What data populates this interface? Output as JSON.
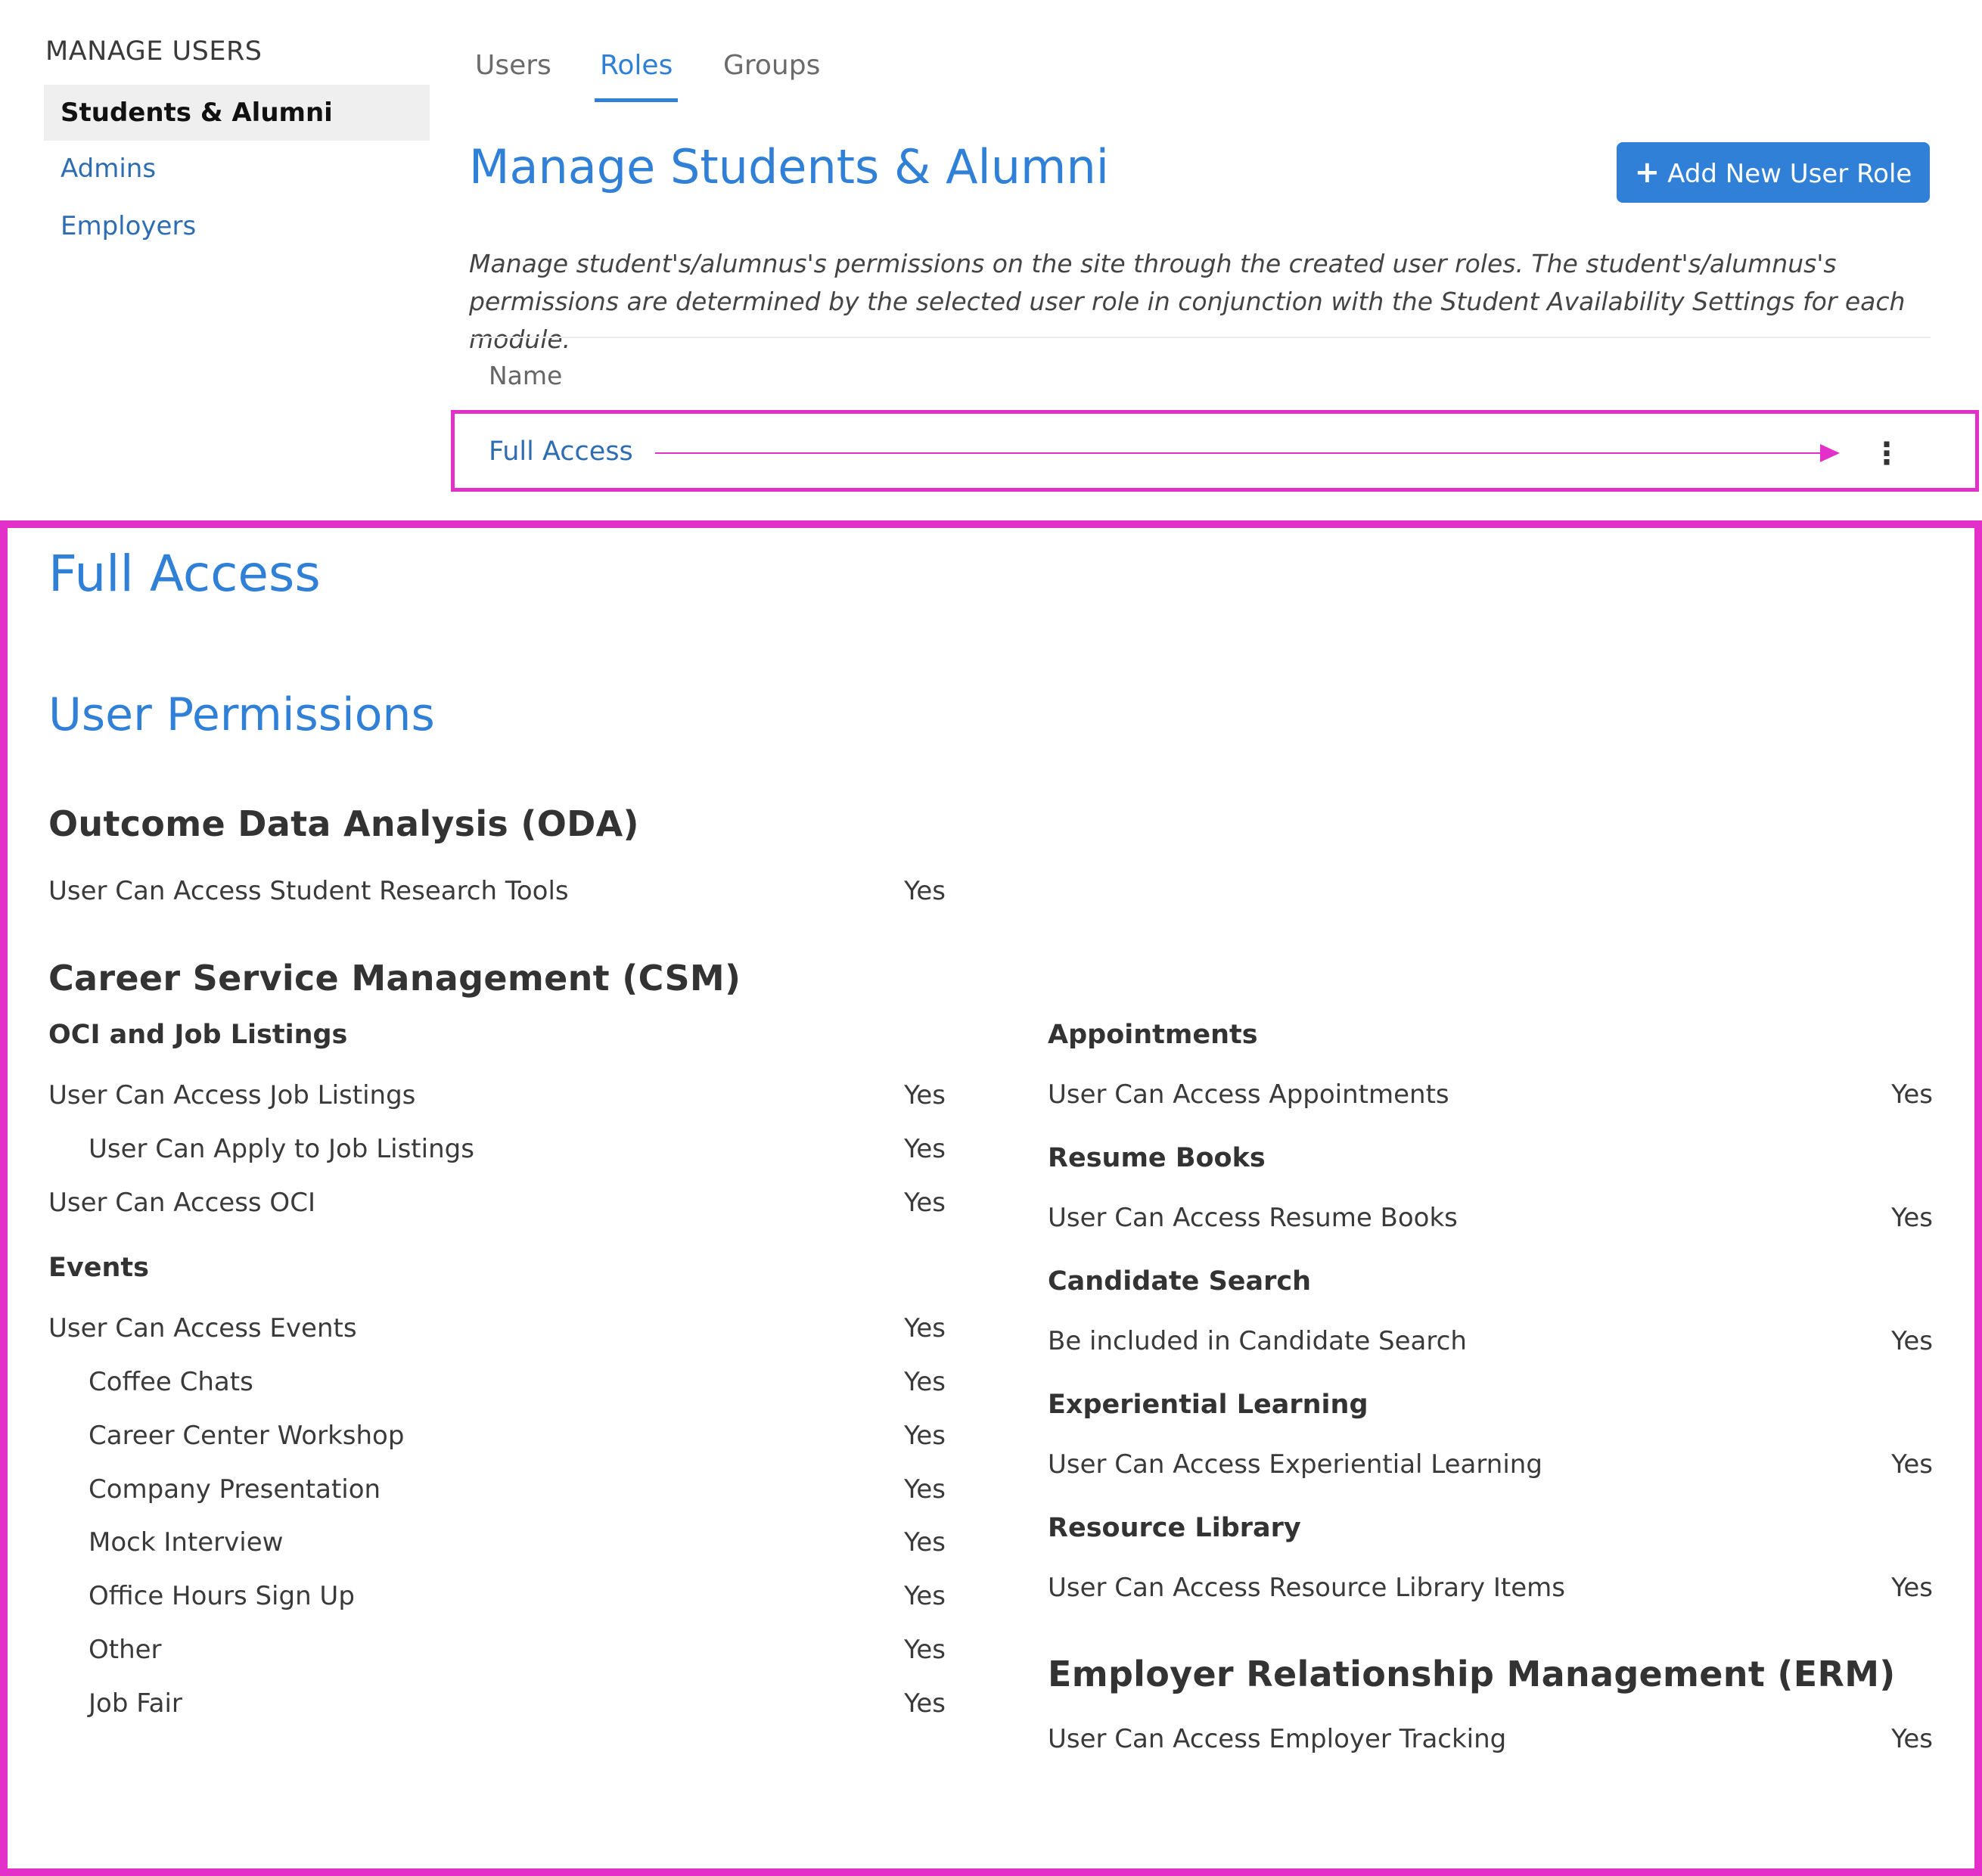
{
  "sidebar": {
    "title": "MANAGE USERS",
    "items": [
      {
        "label": "Students & Alumni"
      },
      {
        "label": "Admins"
      },
      {
        "label": "Employers"
      }
    ]
  },
  "tabs": [
    {
      "label": "Users"
    },
    {
      "label": "Roles"
    },
    {
      "label": "Groups"
    }
  ],
  "header": {
    "title": "Manage Students & Alumni",
    "add_button": "Add New User Role",
    "description": "Manage student's/alumnus's permissions on the site through the created user roles. The student's/alumnus's permissions are determined by the selected user role in conjunction with the Student Availability Settings for each module."
  },
  "table": {
    "column_name": "Name",
    "rows": [
      {
        "name": "Full Access"
      }
    ]
  },
  "detail": {
    "title": "Full Access",
    "permissions_title": "User Permissions",
    "oda": {
      "heading": "Outcome Data Analysis (ODA)",
      "items": [
        {
          "label": "User Can Access Student Research Tools",
          "value": "Yes"
        }
      ]
    },
    "csm": {
      "heading": "Career Service Management (CSM)",
      "oci": {
        "heading": "OCI and Job Listings",
        "items": [
          {
            "label": "User Can Access Job Listings",
            "value": "Yes"
          },
          {
            "label": "User Can Apply to Job Listings",
            "value": "Yes"
          },
          {
            "label": "User Can Access OCI",
            "value": "Yes"
          }
        ]
      },
      "events": {
        "heading": "Events",
        "items": [
          {
            "label": "User Can Access Events",
            "value": "Yes"
          },
          {
            "label": "Coffee Chats",
            "value": "Yes"
          },
          {
            "label": "Career Center Workshop",
            "value": "Yes"
          },
          {
            "label": "Company Presentation",
            "value": "Yes"
          },
          {
            "label": "Mock Interview",
            "value": "Yes"
          },
          {
            "label": "Office Hours Sign Up",
            "value": "Yes"
          },
          {
            "label": "Other",
            "value": "Yes"
          },
          {
            "label": "Job Fair",
            "value": "Yes"
          }
        ]
      },
      "right": [
        {
          "heading": "Appointments",
          "label": "User Can Access Appointments",
          "value": "Yes"
        },
        {
          "heading": "Resume Books",
          "label": "User Can Access Resume Books",
          "value": "Yes"
        },
        {
          "heading": "Candidate Search",
          "label": "Be included in Candidate Search",
          "value": "Yes"
        },
        {
          "heading": "Experiential Learning",
          "label": "User Can Access Experiential Learning",
          "value": "Yes"
        },
        {
          "heading": "Resource Library",
          "label": "User Can Access Resource Library Items",
          "value": "Yes"
        }
      ]
    },
    "erm": {
      "heading": "Employer Relationship Management (ERM)",
      "items": [
        {
          "label": "User Can Access Employer Tracking",
          "value": "Yes"
        }
      ]
    }
  },
  "colors": {
    "accent": "#2f80d6",
    "highlight": "#e330c8"
  }
}
